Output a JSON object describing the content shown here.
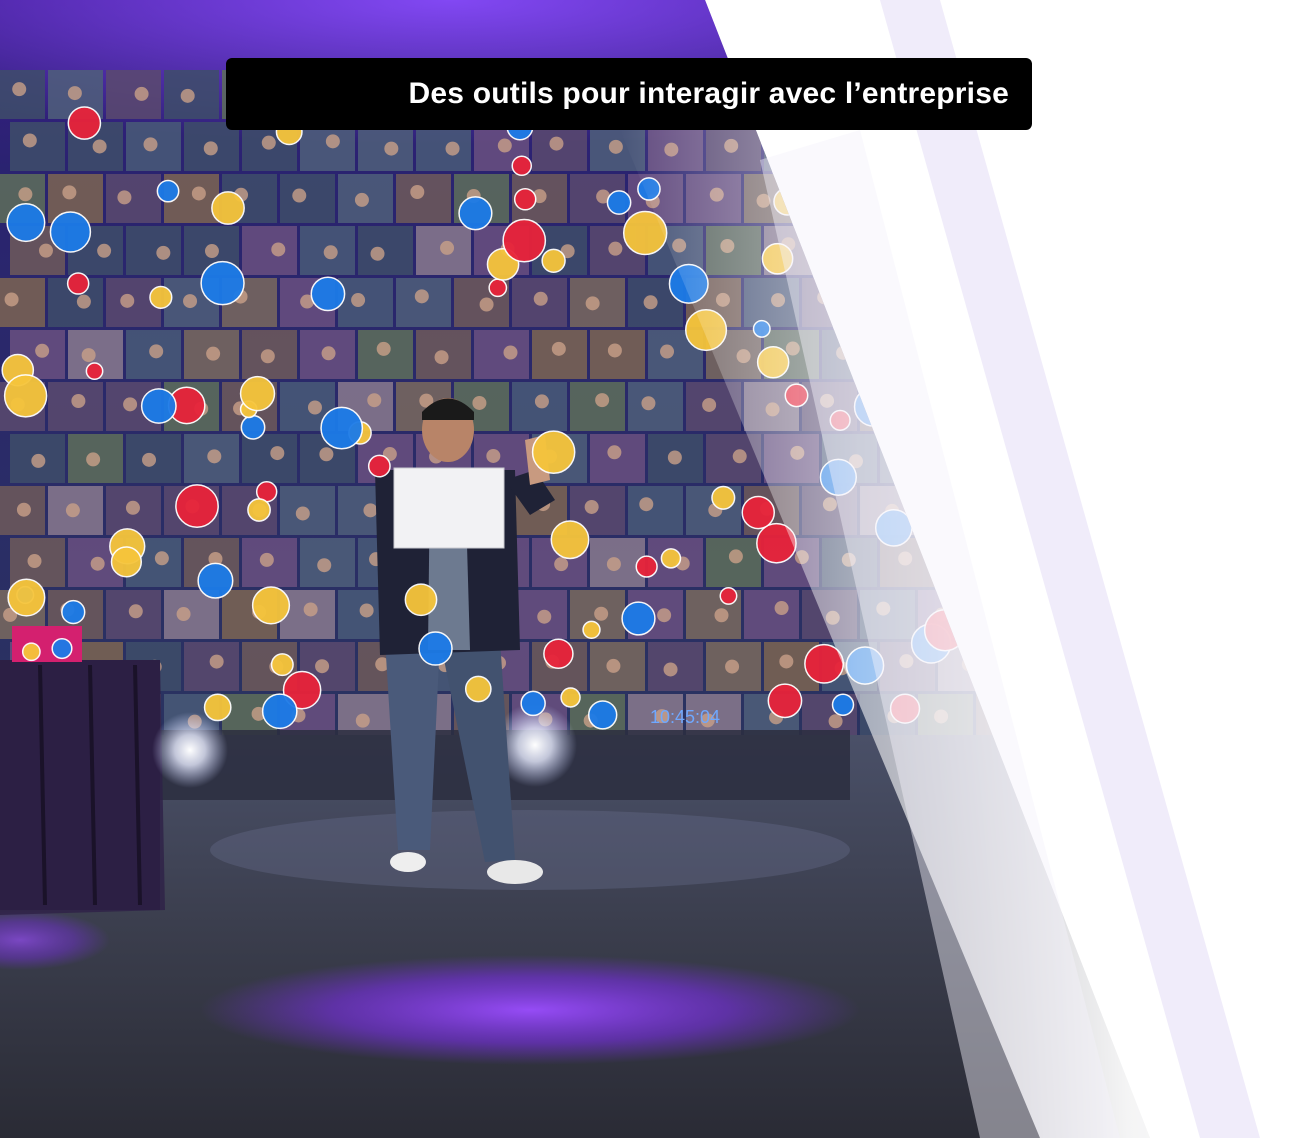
{
  "caption": {
    "text": "Des outils pour interagir avec l’entreprise"
  },
  "stage": {
    "clock_text": "10:45:04"
  },
  "colors": {
    "caption_bg": "#000000",
    "caption_fg": "#ffffff",
    "spot_purple": "#6f2bd6",
    "like_blue": "#1c7be8",
    "heart_red": "#e8233a",
    "haha_yellow": "#f6c53b"
  }
}
